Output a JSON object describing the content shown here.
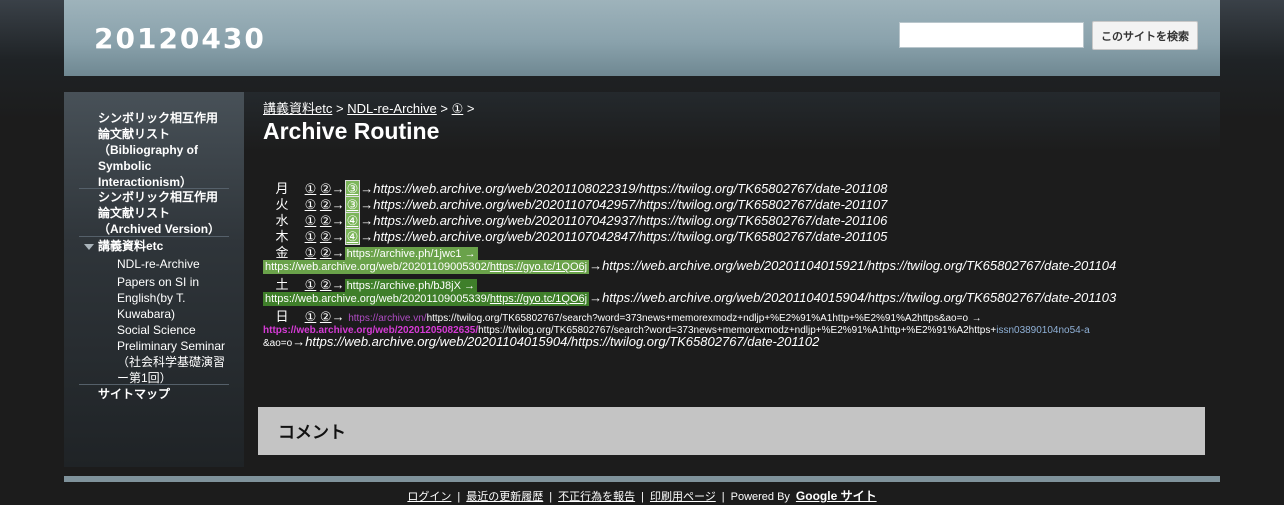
{
  "header": {
    "site_title": "20120430",
    "search_placeholder": "",
    "search_button": "このサイトを検索"
  },
  "sidebar": {
    "items": [
      {
        "label": "シンボリック相互作用論文献リスト（Bibliography of Symbolic Interactionism）"
      },
      {
        "label": "シンボリック相互作用論文献リスト（Archived Version）"
      },
      {
        "label": "講義資料etc"
      },
      {
        "label": "NDL-re-Archive"
      },
      {
        "label": "Papers on SI in English(by T. Kuwabara)"
      },
      {
        "label": "Social Science Preliminary Seminar（社会科学基礎演習ー第1回）"
      },
      {
        "label": "サイトマップ"
      }
    ],
    "item0_lines": [
      "シンボリック相互作用",
      "論文献リスト",
      "（Bibliography of",
      "Symbolic",
      "Interactionism）"
    ],
    "item1_lines": [
      "シンボリック相互作用",
      "論文献リスト",
      "（Archived Version）"
    ],
    "item4_lines": [
      "Papers on SI in",
      "English(by T.",
      "Kuwabara)"
    ],
    "item5_lines": [
      "Social Science",
      "Preliminary Seminar",
      "（社会科学基礎演習",
      "ー第1回）"
    ]
  },
  "breadcrumb": {
    "items": [
      "講義資料etc",
      "NDL-re-Archive",
      "①"
    ],
    "sep": ">"
  },
  "page_title": "Archive Routine",
  "routine": {
    "arrow": "→",
    "c1": "①",
    "c2": "②",
    "c3": "③",
    "c4": "④",
    "rows": [
      {
        "day": "月",
        "box": "③",
        "url": "https://web.archive.org/web/20201108022319/https://twilog.org/TK65802767/date-201108"
      },
      {
        "day": "火",
        "box": "③",
        "url": "https://web.archive.org/web/20201107042957/https://twilog.org/TK65802767/date-201107"
      },
      {
        "day": "水",
        "box": "④",
        "url": "https://web.archive.org/web/20201107042937/https://twilog.org/TK65802767/date-201106"
      },
      {
        "day": "木",
        "box": "④",
        "url": "https://web.archive.org/web/20201107042847/https://twilog.org/TK65802767/date-201105"
      }
    ],
    "kin": {
      "day": "金",
      "hl1": "https://archive.ph/1jwc1 →",
      "hl2a": "https://web.archive.org/web/20201109005302/",
      "hl2b": "https://gyo.tc/1QO6j",
      "url": "https://web.archive.org/web/20201104015921/https://twilog.org/TK65802767/date-201104"
    },
    "do": {
      "day": "土",
      "hl1": "https://archive.ph/bJ8jX →",
      "hl2a": "https://web.archive.org/web/20201109005339/",
      "hl2b": "https://gyo.tc/1QO6j",
      "url": "https://web.archive.org/web/20201104015904/https://twilog.org/TK65802767/date-201103"
    },
    "nichi": {
      "day": "日",
      "p1": "https://archive.vn/",
      "t1": "https://twilog.org/TK65802767/search?word=373news+memorexmodz+ndljp+%E2%91%A1http+%E2%91%A2https&ao=o",
      "a1": "→",
      "p2": "https://web.archive.org/web/20201205082635/",
      "t2": "https://twilog.org/TK65802767/search?word=373news+memorexmodz+ndljp+%E2%91%A1http+%E2%91%A2https+",
      "b1": "issn03890104no54-a",
      "t3": "&ao=o",
      "url": "https://web.archive.org/web/20201104015904/https://twilog.org/TK65802767/date-201102"
    }
  },
  "comments": {
    "title": "コメント"
  },
  "footer": {
    "links": [
      "ログイン",
      "最近の更新履歴",
      "不正行為を報告",
      "印刷用ページ"
    ],
    "sep": "|",
    "powered_by": "Powered By",
    "google_sites": "Google サイト"
  }
}
